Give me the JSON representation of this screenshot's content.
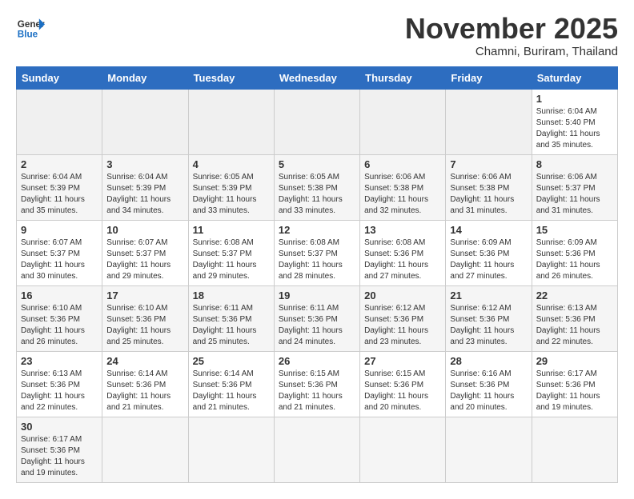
{
  "header": {
    "logo_general": "General",
    "logo_blue": "Blue",
    "month_title": "November 2025",
    "location": "Chamni, Buriram, Thailand"
  },
  "days_of_week": [
    "Sunday",
    "Monday",
    "Tuesday",
    "Wednesday",
    "Thursday",
    "Friday",
    "Saturday"
  ],
  "weeks": [
    {
      "days": [
        {
          "num": "",
          "info": "",
          "empty": true
        },
        {
          "num": "",
          "info": "",
          "empty": true
        },
        {
          "num": "",
          "info": "",
          "empty": true
        },
        {
          "num": "",
          "info": "",
          "empty": true
        },
        {
          "num": "",
          "info": "",
          "empty": true
        },
        {
          "num": "",
          "info": "",
          "empty": true
        },
        {
          "num": "1",
          "info": "Sunrise: 6:04 AM\nSunset: 5:40 PM\nDaylight: 11 hours\nand 35 minutes."
        }
      ]
    },
    {
      "days": [
        {
          "num": "2",
          "info": "Sunrise: 6:04 AM\nSunset: 5:39 PM\nDaylight: 11 hours\nand 35 minutes."
        },
        {
          "num": "3",
          "info": "Sunrise: 6:04 AM\nSunset: 5:39 PM\nDaylight: 11 hours\nand 34 minutes."
        },
        {
          "num": "4",
          "info": "Sunrise: 6:05 AM\nSunset: 5:39 PM\nDaylight: 11 hours\nand 33 minutes."
        },
        {
          "num": "5",
          "info": "Sunrise: 6:05 AM\nSunset: 5:38 PM\nDaylight: 11 hours\nand 33 minutes."
        },
        {
          "num": "6",
          "info": "Sunrise: 6:06 AM\nSunset: 5:38 PM\nDaylight: 11 hours\nand 32 minutes."
        },
        {
          "num": "7",
          "info": "Sunrise: 6:06 AM\nSunset: 5:38 PM\nDaylight: 11 hours\nand 31 minutes."
        },
        {
          "num": "8",
          "info": "Sunrise: 6:06 AM\nSunset: 5:37 PM\nDaylight: 11 hours\nand 31 minutes."
        }
      ]
    },
    {
      "days": [
        {
          "num": "9",
          "info": "Sunrise: 6:07 AM\nSunset: 5:37 PM\nDaylight: 11 hours\nand 30 minutes."
        },
        {
          "num": "10",
          "info": "Sunrise: 6:07 AM\nSunset: 5:37 PM\nDaylight: 11 hours\nand 29 minutes."
        },
        {
          "num": "11",
          "info": "Sunrise: 6:08 AM\nSunset: 5:37 PM\nDaylight: 11 hours\nand 29 minutes."
        },
        {
          "num": "12",
          "info": "Sunrise: 6:08 AM\nSunset: 5:37 PM\nDaylight: 11 hours\nand 28 minutes."
        },
        {
          "num": "13",
          "info": "Sunrise: 6:08 AM\nSunset: 5:36 PM\nDaylight: 11 hours\nand 27 minutes."
        },
        {
          "num": "14",
          "info": "Sunrise: 6:09 AM\nSunset: 5:36 PM\nDaylight: 11 hours\nand 27 minutes."
        },
        {
          "num": "15",
          "info": "Sunrise: 6:09 AM\nSunset: 5:36 PM\nDaylight: 11 hours\nand 26 minutes."
        }
      ]
    },
    {
      "days": [
        {
          "num": "16",
          "info": "Sunrise: 6:10 AM\nSunset: 5:36 PM\nDaylight: 11 hours\nand 26 minutes."
        },
        {
          "num": "17",
          "info": "Sunrise: 6:10 AM\nSunset: 5:36 PM\nDaylight: 11 hours\nand 25 minutes."
        },
        {
          "num": "18",
          "info": "Sunrise: 6:11 AM\nSunset: 5:36 PM\nDaylight: 11 hours\nand 25 minutes."
        },
        {
          "num": "19",
          "info": "Sunrise: 6:11 AM\nSunset: 5:36 PM\nDaylight: 11 hours\nand 24 minutes."
        },
        {
          "num": "20",
          "info": "Sunrise: 6:12 AM\nSunset: 5:36 PM\nDaylight: 11 hours\nand 23 minutes."
        },
        {
          "num": "21",
          "info": "Sunrise: 6:12 AM\nSunset: 5:36 PM\nDaylight: 11 hours\nand 23 minutes."
        },
        {
          "num": "22",
          "info": "Sunrise: 6:13 AM\nSunset: 5:36 PM\nDaylight: 11 hours\nand 22 minutes."
        }
      ]
    },
    {
      "days": [
        {
          "num": "23",
          "info": "Sunrise: 6:13 AM\nSunset: 5:36 PM\nDaylight: 11 hours\nand 22 minutes."
        },
        {
          "num": "24",
          "info": "Sunrise: 6:14 AM\nSunset: 5:36 PM\nDaylight: 11 hours\nand 21 minutes."
        },
        {
          "num": "25",
          "info": "Sunrise: 6:14 AM\nSunset: 5:36 PM\nDaylight: 11 hours\nand 21 minutes."
        },
        {
          "num": "26",
          "info": "Sunrise: 6:15 AM\nSunset: 5:36 PM\nDaylight: 11 hours\nand 21 minutes."
        },
        {
          "num": "27",
          "info": "Sunrise: 6:15 AM\nSunset: 5:36 PM\nDaylight: 11 hours\nand 20 minutes."
        },
        {
          "num": "28",
          "info": "Sunrise: 6:16 AM\nSunset: 5:36 PM\nDaylight: 11 hours\nand 20 minutes."
        },
        {
          "num": "29",
          "info": "Sunrise: 6:17 AM\nSunset: 5:36 PM\nDaylight: 11 hours\nand 19 minutes."
        }
      ]
    },
    {
      "days": [
        {
          "num": "30",
          "info": "Sunrise: 6:17 AM\nSunset: 5:36 PM\nDaylight: 11 hours\nand 19 minutes."
        },
        {
          "num": "",
          "info": "",
          "empty": true
        },
        {
          "num": "",
          "info": "",
          "empty": true
        },
        {
          "num": "",
          "info": "",
          "empty": true
        },
        {
          "num": "",
          "info": "",
          "empty": true
        },
        {
          "num": "",
          "info": "",
          "empty": true
        },
        {
          "num": "",
          "info": "",
          "empty": true
        }
      ]
    }
  ]
}
